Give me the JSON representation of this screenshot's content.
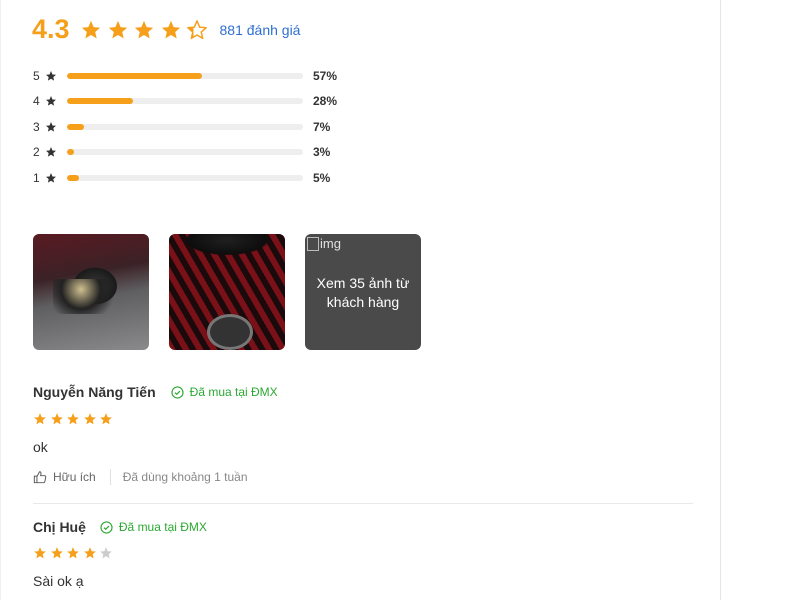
{
  "summary": {
    "score": "4.3",
    "rating_fraction": 0.86,
    "count_text": "881 đánh giá"
  },
  "colors": {
    "accent": "#f59f1b",
    "star_empty": "#cccccc",
    "link": "#2f6fd0",
    "verified": "#2ba832"
  },
  "distribution": [
    {
      "stars": "5",
      "percent": "57%",
      "value": 57
    },
    {
      "stars": "4",
      "percent": "28%",
      "value": 28
    },
    {
      "stars": "3",
      "percent": "7%",
      "value": 7
    },
    {
      "stars": "2",
      "percent": "3%",
      "value": 3
    },
    {
      "stars": "1",
      "percent": "5%",
      "value": 5
    }
  ],
  "photos": {
    "broken_alt": "img",
    "more_text": "Xem 35 ảnh từ khách hàng"
  },
  "reviews": [
    {
      "name": "Nguyễn Năng Tiến",
      "badge": "Đã mua tại ĐMX",
      "stars": 5,
      "text": "ok",
      "helpful": "Hữu ích",
      "used": "Đã dùng khoảng 1 tuần"
    },
    {
      "name": "Chị Huệ",
      "badge": "Đã mua tại ĐMX",
      "stars": 4,
      "text": "Sài ok ạ"
    }
  ]
}
